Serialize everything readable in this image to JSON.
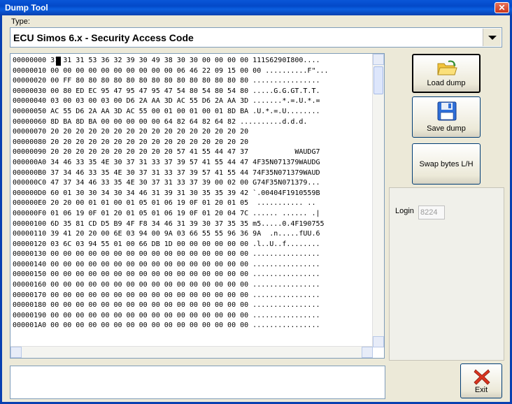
{
  "window": {
    "title": "Dump Tool",
    "close_glyph": "✕"
  },
  "type": {
    "label": "Type:",
    "value": "ECU Simos 6.x - Security Access Code"
  },
  "hex_lines": [
    "00000000 31 31 31 53 36 32 39 30 49 38 30 30 00 00 00 00 111S6290I800....",
    "00000010 00 00 00 00 00 00 00 00 00 00 06 46 22 09 15 00 00 ..........F\"...",
    "00000020 00 FF 80 80 80 80 80 80 80 80 80 80 80 80 80 80 ................",
    "00000030 00 80 ED EC 95 47 95 47 95 47 54 80 54 80 54 80 .....G.G.GT.T.T.",
    "00000040 03 00 03 00 03 00 D6 2A AA 3D AC 55 D6 2A AA 3D .......*.=.U.*.=",
    "00000050 AC 55 D6 2A AA 3D AC 55 00 01 00 01 00 01 8D BA .U.*.=.U........",
    "00000060 8D BA 8D BA 00 00 00 00 00 64 82 64 82 64 82 ..........d.d.d.",
    "00000070 20 20 20 20 20 20 20 20 20 20 20 20 20 20 20 20",
    "00000080 20 20 20 20 20 20 20 20 20 20 20 20 20 20 20 20",
    "00000090 20 20 20 20 20 20 20 20 20 20 57 41 55 44 47 37           WAUDG7",
    "000000A0 34 46 33 35 4E 30 37 31 33 37 39 57 41 55 44 47 4F35N071379WAUDG",
    "000000B0 37 34 46 33 35 4E 30 37 31 33 37 39 57 41 55 44 74F35N071379WAUD",
    "000000C0 47 37 34 46 33 35 4E 30 37 31 33 37 39 00 02 00 G74F35N071379...",
    "000000D0 60 01 30 30 34 30 34 46 31 39 31 30 35 35 39 42 `.00404F1910559B",
    "000000E0 20 20 00 01 01 00 01 05 01 06 19 0F 01 20 01 05  ........... ..",
    "000000F0 01 06 19 0F 01 20 01 05 01 06 19 0F 01 20 04 7C ...... ...... .|",
    "00000100 6D 35 81 CD D5 B9 4F F8 34 46 31 39 30 37 35 35 m5.....0.4F190755",
    "00000110 39 41 20 20 00 6E 03 94 00 9A 03 66 55 55 96 36 9A  .n.....fUU.6",
    "00000120 03 6C 03 94 55 01 00 66 DB 1D 00 00 00 00 00 00 .l..U..f........",
    "00000130 00 00 00 00 00 00 00 00 00 00 00 00 00 00 00 00 ................",
    "00000140 00 00 00 00 00 00 00 00 00 00 00 00 00 00 00 00 ................",
    "00000150 00 00 00 00 00 00 00 00 00 00 00 00 00 00 00 00 ................",
    "00000160 00 00 00 00 00 00 00 00 00 00 00 00 00 00 00 00 ................",
    "00000170 00 00 00 00 00 00 00 00 00 00 00 00 00 00 00 00 ................",
    "00000180 00 00 00 00 00 00 00 00 00 00 00 00 00 00 00 00 ................",
    "00000190 00 00 00 00 00 00 00 00 00 00 00 00 00 00 00 00 ................",
    "000001A0 00 00 00 00 00 00 00 00 00 00 00 00 00 00 00 00 ................"
  ],
  "buttons": {
    "load_dump": "Load dump",
    "save_dump": "Save dump",
    "swap_bytes": "Swap bytes L/H",
    "exit": "Exit"
  },
  "login": {
    "label": "Login",
    "value": "8224"
  },
  "icons": {
    "load": "folder-open-icon",
    "save": "floppy-disk-icon",
    "exit": "red-x-icon"
  },
  "colors": {
    "title_bar": "#0349c8",
    "exit_x": "#d9341f",
    "folder": "#f3c43b",
    "floppy": "#2f6fd8"
  }
}
